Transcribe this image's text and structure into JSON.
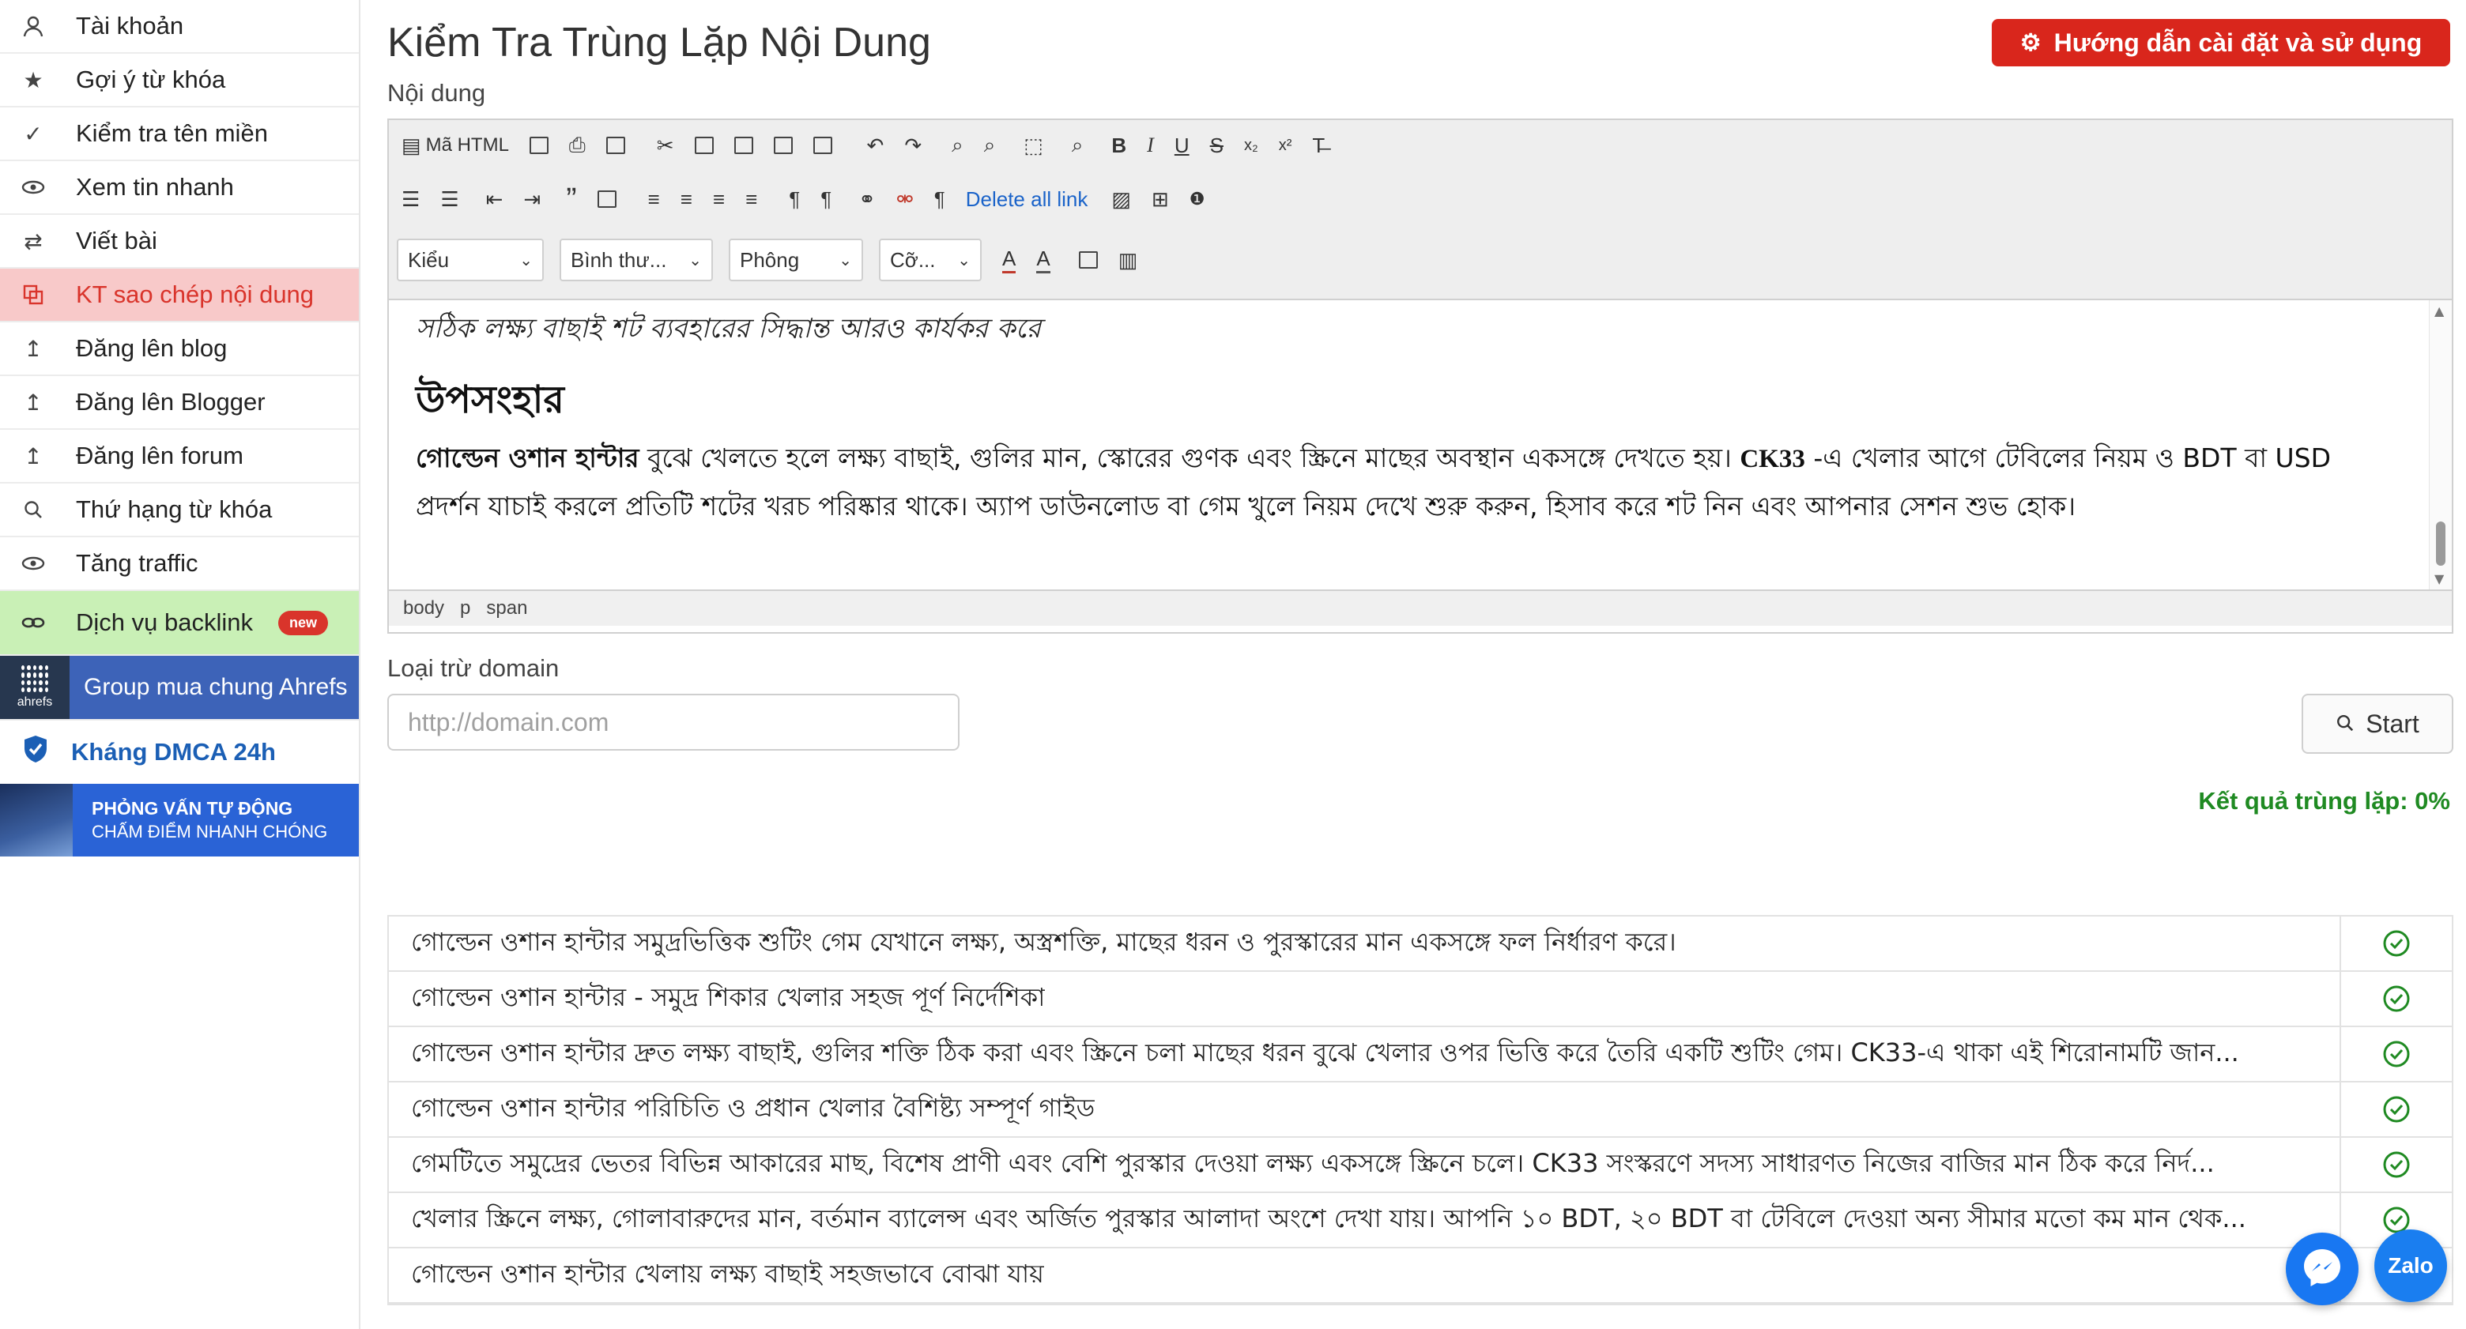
{
  "sidebar": {
    "items": [
      {
        "label": "Tài khoản",
        "icon": "user-icon"
      },
      {
        "label": "Gợi ý từ khóa",
        "icon": "star-icon"
      },
      {
        "label": "Kiểm tra tên miền",
        "icon": "check-icon"
      },
      {
        "label": "Xem tin nhanh",
        "icon": "eye-icon"
      },
      {
        "label": "Viết bài",
        "icon": "swap-icon"
      },
      {
        "label": "KT sao chép nội dung",
        "icon": "copy-icon"
      },
      {
        "label": "Đăng lên blog",
        "icon": "upload-icon"
      },
      {
        "label": "Đăng lên Blogger",
        "icon": "upload-icon"
      },
      {
        "label": "Đăng lên forum",
        "icon": "upload-icon"
      },
      {
        "label": "Thứ hạng từ khóa",
        "icon": "search-icon"
      },
      {
        "label": "Tăng traffic",
        "icon": "eye-icon"
      },
      {
        "label": "Dịch vụ backlink",
        "icon": "link-icon",
        "badge": "new"
      }
    ],
    "ahrefs_banner": {
      "label": "Group mua chung Ahrefs",
      "logo_text": "ahrefs"
    },
    "dmca": {
      "label": "Kháng DMCA 24h"
    },
    "interview_banner": {
      "line1": "PHỎNG VẤN TỰ ĐỘNG",
      "line2": "CHẤM ĐIỂM NHANH CHÓNG"
    }
  },
  "header": {
    "title": "Kiểm Tra Trùng Lặp Nội Dung",
    "guide_button": "Hướng dẫn cài đặt và sử dụng",
    "content_label": "Nội dung"
  },
  "toolbar": {
    "html_source": "Mã HTML",
    "bold": "B",
    "italic": "I",
    "underline": "U",
    "strike": "S",
    "sub": "x₂",
    "sup": "x²",
    "clear": "T̶",
    "quote": "”",
    "para1": "¶",
    "para2": "¶",
    "para3": "¶",
    "delete_all_link": "Delete all link",
    "style_select": "Kiểu",
    "format_select": "Bình thư...",
    "font_select": "Phông",
    "size_select": "Cỡ...",
    "text_color": "A",
    "bg_color": "A"
  },
  "editor": {
    "line0": "সঠিক লক্ষ্য বাছাই শট ব্যবহারের সিদ্ধান্ত আরও কার্যকর করে",
    "heading": "উপসংহার",
    "para_bold": "গোল্ডেন ওশান হান্টার",
    "para_rest": " বুঝে খেলতে হলে লক্ষ্য বাছাই, গুলির মান, স্কোরের গুণক এবং স্ক্রিনে মাছের অবস্থান একসঙ্গে দেখতে হয়। ",
    "para_ck": "CK33",
    "para_end": " -এ খেলার আগে টেবিলের নিয়ম ও BDT বা USD প্রদর্শন যাচাই করলে প্রতিটি শটের খরচ পরিষ্কার থাকে। অ্যাপ ডাউনলোড বা গেম খুলে নিয়ম দেখে শুরু করুন, হিসাব করে শট নিন এবং আপনার সেশন শুভ হোক।",
    "status_path": [
      "body",
      "p",
      "span"
    ]
  },
  "exclude": {
    "label": "Loại trừ domain",
    "placeholder": "http://domain.com",
    "start_button": "Start"
  },
  "result": {
    "text": "Kết quả trùng lặp: 0%"
  },
  "results_table": [
    {
      "text": "গোল্ডেন ওশান হান্টার সমুদ্রভিত্তিক শুটিং গেম যেখানে লক্ষ্য, অস্ত্রশক্তি, মাছের ধরন ও পুরস্কারের মান একসঙ্গে ফল নির্ধারণ করে।",
      "status": "ok"
    },
    {
      "text": "গোল্ডেন ওশান হান্টার - সমুদ্র শিকার খেলার সহজ পূর্ণ নির্দেশিকা",
      "status": "ok"
    },
    {
      "text": "গোল্ডেন ওশান হান্টার দ্রুত লক্ষ্য বাছাই, গুলির শক্তি ঠিক করা এবং স্ক্রিনে চলা মাছের ধরন বুঝে খেলার ওপর ভিত্তি করে তৈরি একটি শুটিং গেম। CK33-এ থাকা এই শিরোনামটি জান...",
      "status": "ok"
    },
    {
      "text": "গোল্ডেন ওশান হান্টার পরিচিতি ও প্রধান খেলার বৈশিষ্ট্য সম্পূর্ণ গাইড",
      "status": "ok"
    },
    {
      "text": "গেমটিতে সমুদ্রের ভেতর বিভিন্ন আকারের মাছ, বিশেষ প্রাণী এবং বেশি পুরস্কার দেওয়া লক্ষ্য একসঙ্গে স্ক্রিনে চলে। CK33 সংস্করণে সদস্য সাধারণত নিজের বাজির মান ঠিক করে নির্দ...",
      "status": "ok"
    },
    {
      "text": "খেলার স্ক্রিনে লক্ষ্য, গোলাবারুদের মান, বর্তমান ব্যালেন্স এবং অর্জিত পুরস্কার আলাদা অংশে দেখা যায়। আপনি ১০ BDT, ২০ BDT বা টেবিলে দেওয়া অন্য সীমার মতো কম মান থেক...",
      "status": "ok"
    },
    {
      "text": "গোল্ডেন ওশান হান্টার খেলায় লক্ষ্য বাছাই সহজভাবে বোঝা যায়",
      "status": "none"
    }
  ],
  "floating": {
    "messenger": "messenger-icon",
    "zalo": "Zalo"
  },
  "colors": {
    "accent_red": "#d9261c",
    "active_bg": "#f8c9c9",
    "success_green": "#1f8a22",
    "link_blue": "#1a63c9"
  }
}
